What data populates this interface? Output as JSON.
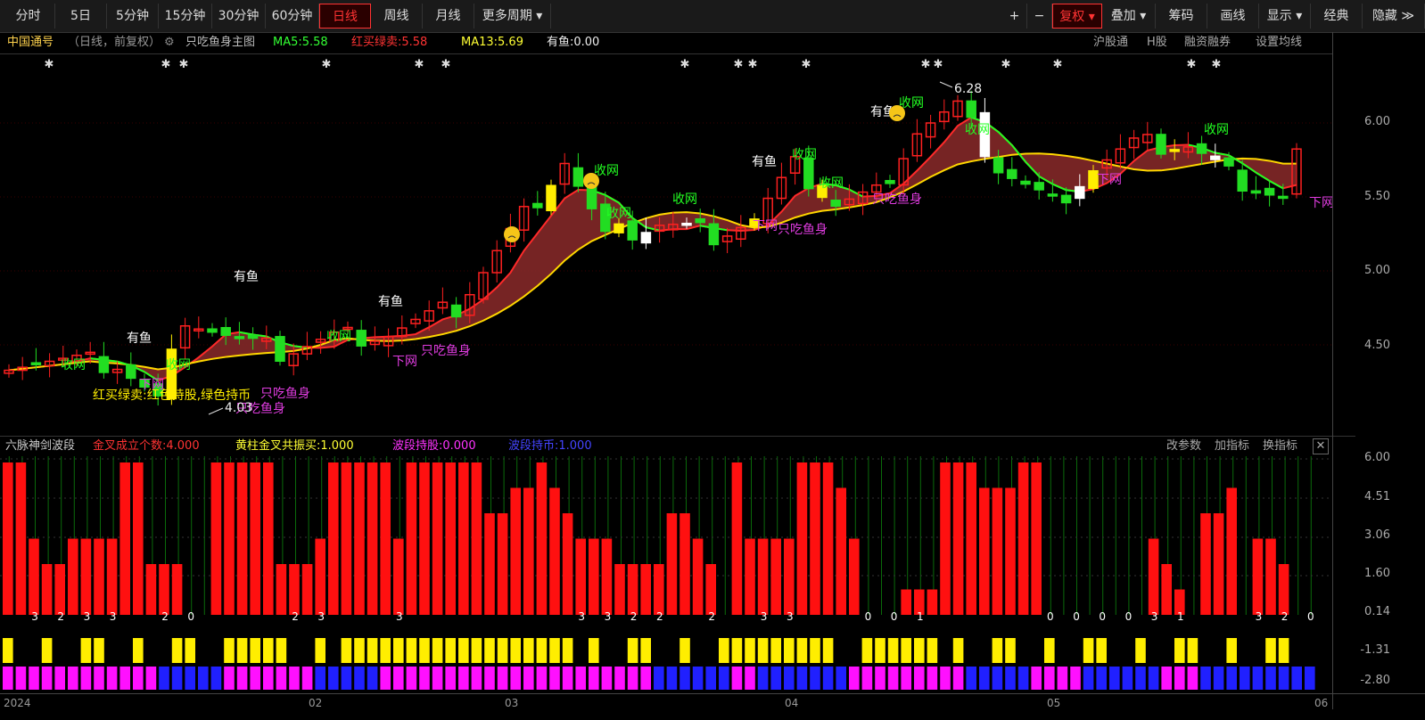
{
  "toolbar": {
    "left": [
      "分时",
      "5日",
      "5分钟",
      "15分钟",
      "30分钟",
      "60分钟",
      "日线",
      "周线",
      "月线",
      "更多周期"
    ],
    "active": "日线",
    "right": [
      "+",
      "−",
      "复权",
      "叠加",
      "筹码",
      "画线",
      "显示",
      "经典",
      "隐藏"
    ]
  },
  "info": {
    "stock": "中国通号",
    "period": "（日线，前复权）",
    "template": "只吃鱼身主图",
    "ma5": "MA5:5.58",
    "buy_sell": "红买绿卖:5.58",
    "ma13": "MA13:5.69",
    "fish": "有鱼:0.00",
    "links": [
      "沪股通",
      "H股",
      "融资融券",
      "设置均线"
    ]
  },
  "annotations": {
    "you_yu": "有鱼",
    "shou_wang": "收网",
    "xia_wang": "下网",
    "zhi_chi": "只吃鱼身",
    "legend_text": "红买绿卖:红色持股,绿色持币",
    "low_label": "4.03",
    "high_label": "6.28"
  },
  "main_axis": [
    "6.00",
    "5.50",
    "5.00",
    "4.50"
  ],
  "indicator": {
    "name": "六脉神剑波段",
    "golden": "金叉成立个数:4.000",
    "yellow": "黄柱金叉共振买:1.000",
    "hold": "波段持股:0.000",
    "cash": "波段持币:1.000",
    "links": [
      "改参数",
      "加指标",
      "换指标"
    ],
    "axis": [
      "6.00",
      "4.51",
      "3.06",
      "1.60",
      "0.14",
      "-1.31",
      "-2.80"
    ]
  },
  "dates": [
    "2024",
    "02",
    "03",
    "04",
    "05",
    "06"
  ],
  "chart_data": {
    "type": "candlestick",
    "ohlc_approx": [
      [
        4.35,
        4.4,
        4.32,
        4.38
      ],
      [
        4.38,
        4.41,
        4.33,
        4.36
      ],
      [
        4.36,
        4.38,
        4.28,
        4.3
      ],
      [
        4.3,
        4.34,
        4.27,
        4.33
      ],
      [
        4.33,
        4.36,
        4.3,
        4.32
      ],
      [
        4.32,
        4.38,
        4.3,
        4.37
      ],
      [
        4.37,
        4.41,
        4.34,
        4.36
      ],
      [
        4.36,
        4.42,
        4.34,
        4.39
      ],
      [
        4.39,
        4.41,
        4.33,
        4.34
      ],
      [
        4.34,
        4.36,
        4.22,
        4.24
      ],
      [
        4.24,
        4.28,
        4.03,
        4.12
      ],
      [
        4.12,
        4.27,
        4.03,
        4.24
      ],
      [
        4.24,
        4.74,
        4.22,
        4.7
      ],
      [
        4.7,
        4.82,
        4.58,
        4.6
      ],
      [
        4.6,
        4.78,
        4.56,
        4.66
      ],
      [
        4.66,
        4.7,
        4.55,
        4.59
      ]
    ],
    "high": 6.28,
    "low": 4.03,
    "ylim": [
      4.0,
      6.35
    ]
  }
}
